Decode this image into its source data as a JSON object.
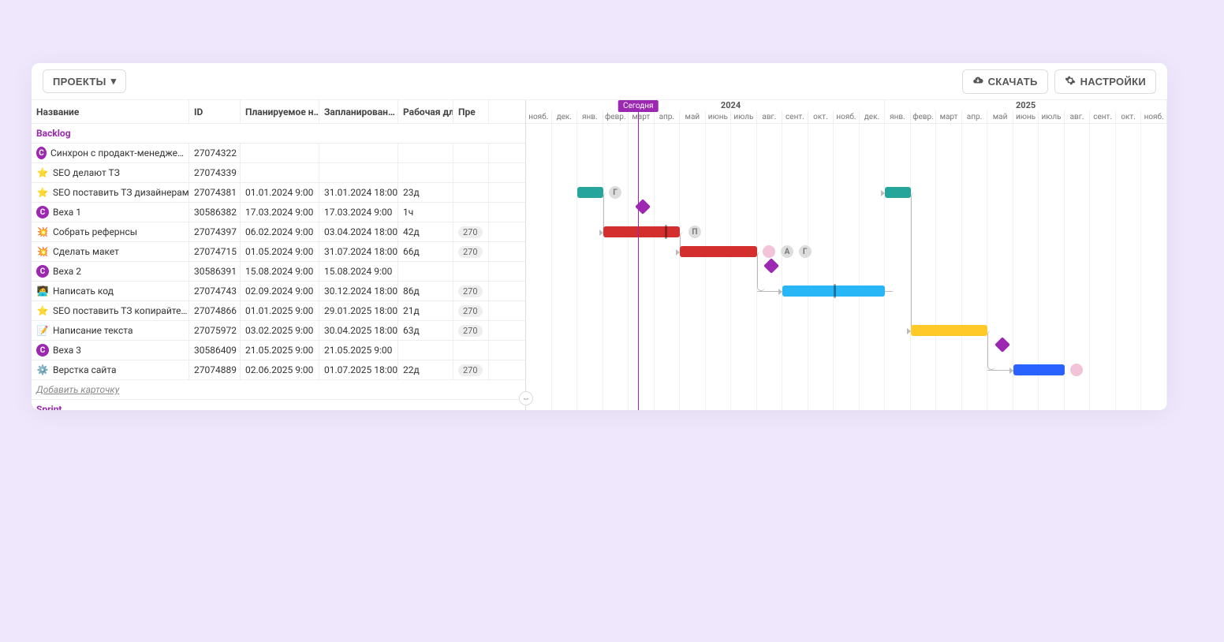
{
  "toolbar": {
    "projects_label": "ПРОЕКТЫ",
    "download_label": "СКАЧАТЬ",
    "settings_label": "НАСТРОЙКИ"
  },
  "columns": {
    "name": "Название",
    "id": "ID",
    "planned_start": "Планируемое н…",
    "planned_end": "Запланирован…",
    "duration": "Рабочая длите…",
    "prev": "Пре"
  },
  "groups": [
    {
      "label": "Backlog"
    },
    {
      "label": "Sprint"
    }
  ],
  "add_card": "Добавить карточку",
  "today_label": "Сегодня",
  "years": [
    "2024",
    "2025"
  ],
  "months": [
    "нояб.",
    "дек.",
    "янв.",
    "февр.",
    "март",
    "апр.",
    "май",
    "июнь",
    "июль",
    "авг.",
    "сент.",
    "окт.",
    "нояб.",
    "дек.",
    "янв.",
    "февр.",
    "март",
    "апр.",
    "май",
    "июнь",
    "июль",
    "авг.",
    "сент.",
    "окт.",
    "нояб."
  ],
  "tasks": [
    {
      "icon": "avatar",
      "name": "Синхрон с продакт-менедже…",
      "id": "27074322",
      "start": "",
      "end": "",
      "dur": "",
      "prev": ""
    },
    {
      "icon": "star",
      "name": "SEO делают ТЗ",
      "id": "27074339",
      "start": "",
      "end": "",
      "dur": "",
      "prev": ""
    },
    {
      "icon": "star",
      "name": "SEO поставить ТЗ дизайнерам",
      "id": "27074381",
      "start": "01.01.2024 9:00",
      "end": "31.01.2024 18:00",
      "dur": "23д",
      "prev": ""
    },
    {
      "icon": "avatar",
      "name": "Веха 1",
      "id": "30586382",
      "start": "17.03.2024 9:00",
      "end": "17.03.2024 9:00",
      "dur": "1ч",
      "prev": ""
    },
    {
      "icon": "collision",
      "name": "Собрать рефернсы",
      "id": "27074397",
      "start": "06.02.2024 9:00",
      "end": "03.04.2024 18:00",
      "dur": "42д",
      "prev": "270"
    },
    {
      "icon": "collision",
      "name": "Сделать макет",
      "id": "27074715",
      "start": "01.05.2024 9:00",
      "end": "31.07.2024 18:00",
      "dur": "66д",
      "prev": "270"
    },
    {
      "icon": "avatar",
      "name": "Веха 2",
      "id": "30586391",
      "start": "15.08.2024 9:00",
      "end": "15.08.2024 9:00",
      "dur": "",
      "prev": ""
    },
    {
      "icon": "person",
      "name": "Написать код",
      "id": "27074743",
      "start": "02.09.2024 9:00",
      "end": "30.12.2024 18:00",
      "dur": "86д",
      "prev": "270"
    },
    {
      "icon": "star",
      "name": "SEO поставить ТЗ копирайте…",
      "id": "27074866",
      "start": "01.01.2025 9:00",
      "end": "29.01.2025 18:00",
      "dur": "21д",
      "prev": "270"
    },
    {
      "icon": "memo",
      "name": "Написание текста",
      "id": "27075972",
      "start": "03.02.2025 9:00",
      "end": "30.04.2025 18:00",
      "dur": "63д",
      "prev": "270"
    },
    {
      "icon": "avatar",
      "name": "Веха 3",
      "id": "30586409",
      "start": "21.05.2025 9:00",
      "end": "21.05.2025 9:00",
      "dur": "",
      "prev": ""
    },
    {
      "icon": "gear",
      "name": "Верстка сайта",
      "id": "27074889",
      "start": "02.06.2025 9:00",
      "end": "01.07.2025 18:00",
      "dur": "22д",
      "prev": "270"
    }
  ],
  "gantt_avatars": {
    "g": "Г",
    "p": "П",
    "a": "А"
  },
  "chart_data": {
    "type": "gantt",
    "x_range": [
      "2023-11",
      "2025-11"
    ],
    "today": "2024-04-10",
    "items": [
      {
        "name": "SEO поставить ТЗ дизайнерам",
        "start": "2024-01-01",
        "end": "2024-01-31",
        "color": "#26a69a"
      },
      {
        "name": "Веха 1",
        "date": "2024-03-17",
        "type": "milestone",
        "color": "#9c27b0"
      },
      {
        "name": "Собрать рефернсы",
        "start": "2024-02-06",
        "end": "2024-04-03",
        "color": "#d32f2f"
      },
      {
        "name": "Сделать макет",
        "start": "2024-05-01",
        "end": "2024-07-31",
        "color": "#d32f2f"
      },
      {
        "name": "Веха 2",
        "date": "2024-08-15",
        "type": "milestone",
        "color": "#9c27b0"
      },
      {
        "name": "Написать код",
        "start": "2024-09-02",
        "end": "2024-12-30",
        "color": "#29b6f6"
      },
      {
        "name": "SEO поставить ТЗ копирайтерам",
        "start": "2025-01-01",
        "end": "2025-01-29",
        "color": "#26a69a"
      },
      {
        "name": "Написание текста",
        "start": "2025-02-03",
        "end": "2025-04-30",
        "color": "#ffca28"
      },
      {
        "name": "Веха 3",
        "date": "2025-05-21",
        "type": "milestone",
        "color": "#9c27b0"
      },
      {
        "name": "Верстка сайта",
        "start": "2025-06-02",
        "end": "2025-07-01",
        "color": "#2962ff"
      }
    ],
    "dependencies": [
      [
        "SEO поставить ТЗ дизайнерам",
        "Собрать рефернсы"
      ],
      [
        "Собрать рефернсы",
        "Сделать макет"
      ],
      [
        "Сделать макет",
        "Написать код"
      ],
      [
        "Написать код",
        "SEO поставить ТЗ копирайтерам"
      ],
      [
        "SEO поставить ТЗ копирайтерам",
        "Написание текста"
      ],
      [
        "Написание текста",
        "Верстка сайта"
      ]
    ]
  }
}
